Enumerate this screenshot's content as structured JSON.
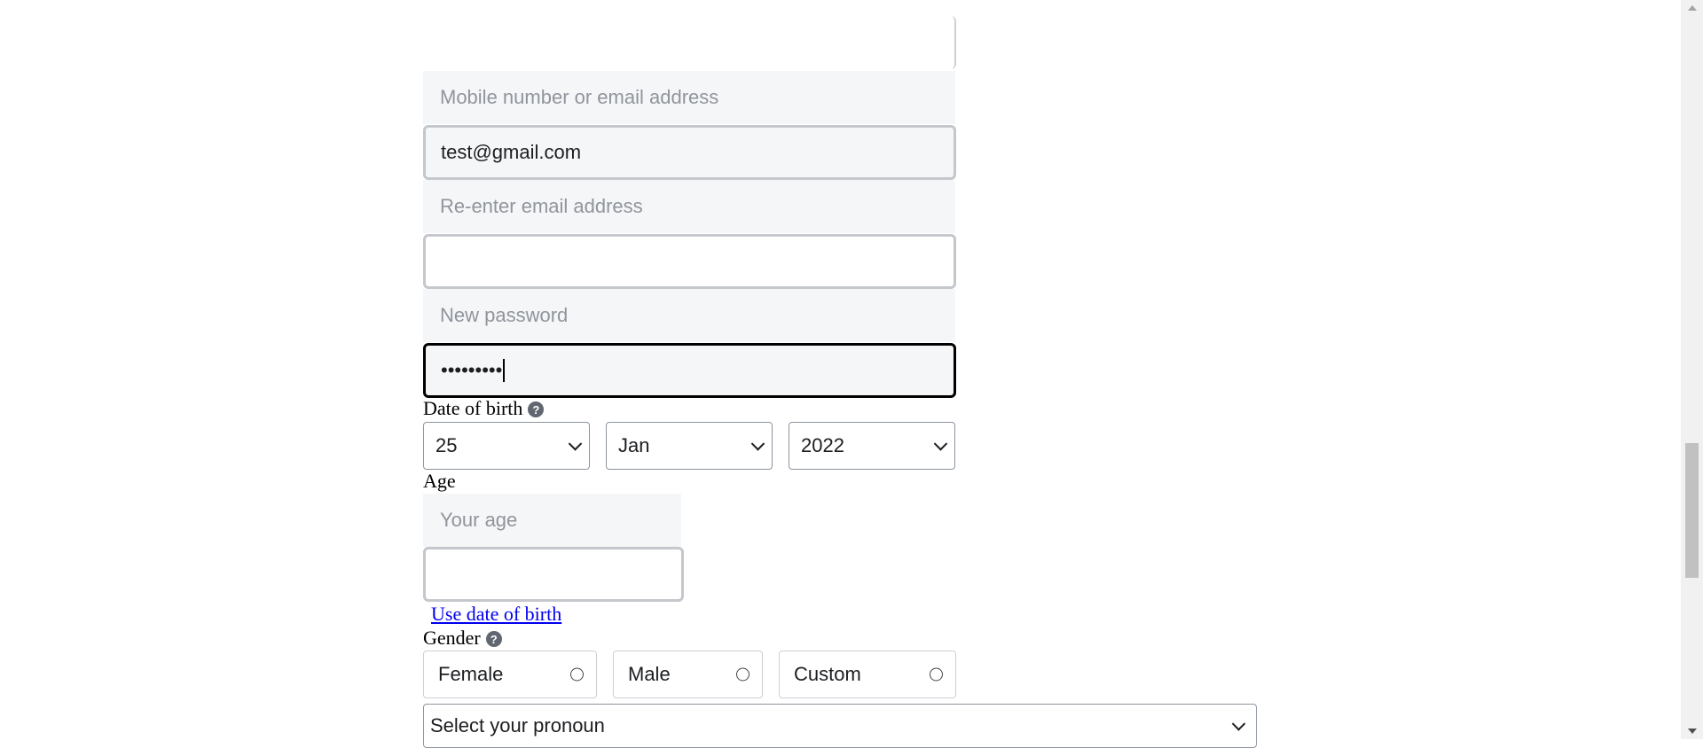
{
  "form": {
    "contact_placeholder": "Mobile number or email address",
    "contact_value": "test@gmail.com",
    "reenter_placeholder": "Re-enter email address",
    "reenter_value": "",
    "password_placeholder": "New password",
    "password_value": "•••••••••",
    "dob_label": "Date of birth",
    "dob_day": "25",
    "dob_month": "Jan",
    "dob_year": "2022",
    "age_label": "Age",
    "age_placeholder": "Your age",
    "age_value": "",
    "use_dob_link": "Use date of birth",
    "gender_label": "Gender",
    "gender_options": [
      "Female",
      "Male",
      "Custom"
    ],
    "pronoun_select": "Select your pronoun"
  },
  "icons": {
    "help": "question-circle-icon",
    "chevron": "chevron-down-icon"
  },
  "colors": {
    "field_background": "#f5f6f7",
    "field_border": "#c4c7cc",
    "link": "#0000ee"
  }
}
